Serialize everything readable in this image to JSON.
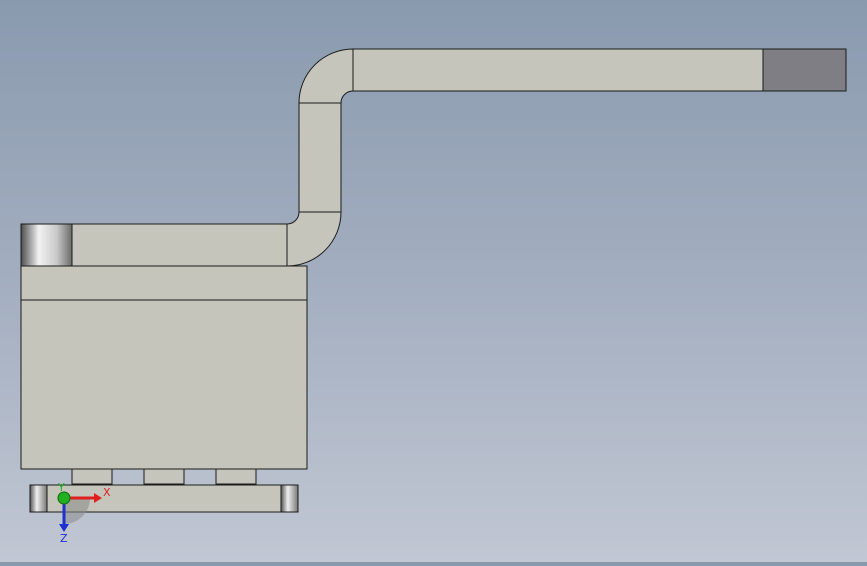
{
  "viewport": {
    "background_top": "#8a9aae",
    "background_bottom": "#c1c7d3",
    "part_face_color": "#c6c5bb",
    "part_edge_color": "#1a1a1a",
    "duct_end_color": "#7e7e84"
  },
  "triad": {
    "x_label": "X",
    "y_label": "Y",
    "z_label": "Z",
    "x_color": "#e02020",
    "y_color": "#20b020",
    "z_color": "#2030d0"
  }
}
